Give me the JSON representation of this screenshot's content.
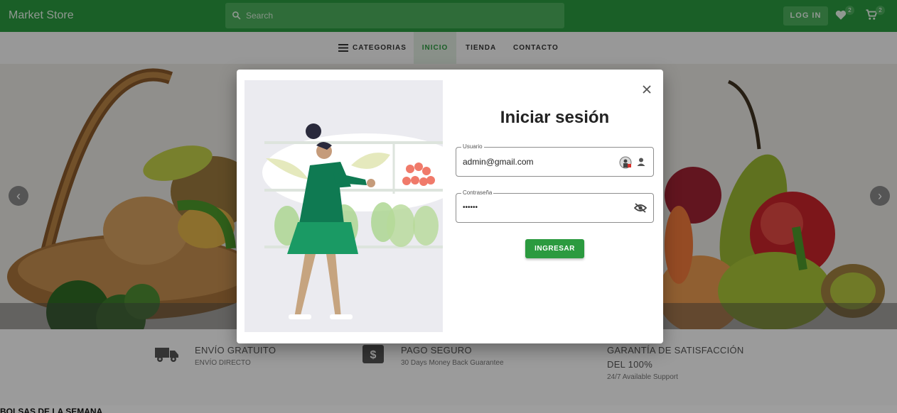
{
  "appbar": {
    "brand": "Market Store",
    "search_placeholder": "Search",
    "login_label": "LOG IN",
    "wishlist_count": "2",
    "cart_count": "2"
  },
  "nav": {
    "categories": "CATEGORIAS",
    "home": "INICIO",
    "store": "TIENDA",
    "contact": "CONTACTO"
  },
  "features": [
    {
      "title": "ENVÍO GRATUITO",
      "subtitle": "ENVÍO DIRECTO",
      "icon": "truck-icon"
    },
    {
      "title": "PAGO SEGURO",
      "subtitle": "30 Days Money Back Guarantee",
      "icon": "dollar-icon"
    },
    {
      "title_line1": "GARANTÍA DE SATISFACCIÓN",
      "title_line2": "DEL 100%",
      "subtitle": "24/7 Available Support"
    }
  ],
  "section_title": "BOLSAS DE LA SEMANA",
  "login_dialog": {
    "title": "Iniciar sesión",
    "username_label": "Usuario",
    "username_value": "admin@gmail.com",
    "password_label": "Contraseña",
    "password_value": "••••••",
    "submit_label": "INGRESAR"
  },
  "colors": {
    "primary": "#2b9a3f",
    "illustration_green": "#0f7a52"
  }
}
